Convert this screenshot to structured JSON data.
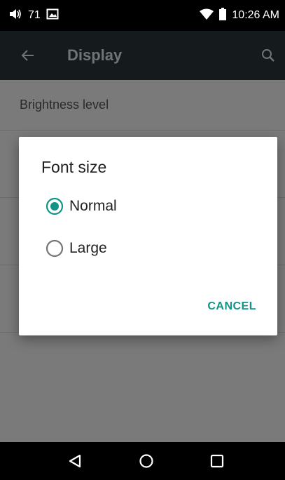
{
  "status_bar": {
    "volume_value": "71",
    "time": "10:26 AM"
  },
  "app_bar": {
    "title": "Display"
  },
  "settings": {
    "items": [
      {
        "label": "Brightness level"
      }
    ]
  },
  "dialog": {
    "title": "Font size",
    "options": [
      {
        "label": "Normal",
        "selected": true
      },
      {
        "label": "Large",
        "selected": false
      }
    ],
    "cancel_label": "CANCEL"
  },
  "colors": {
    "accent": "#119488",
    "status_bar": "#000000",
    "app_bar": "#151a1d",
    "scrim_background": "#7a7a7a",
    "dialog_background": "#ffffff"
  },
  "icons": {
    "status": [
      "volume-icon",
      "image-icon",
      "wifi-icon",
      "battery-icon"
    ],
    "app_bar": [
      "back-arrow-icon",
      "search-icon"
    ],
    "nav": [
      "back-triangle-icon",
      "home-circle-icon",
      "recents-square-icon"
    ]
  }
}
